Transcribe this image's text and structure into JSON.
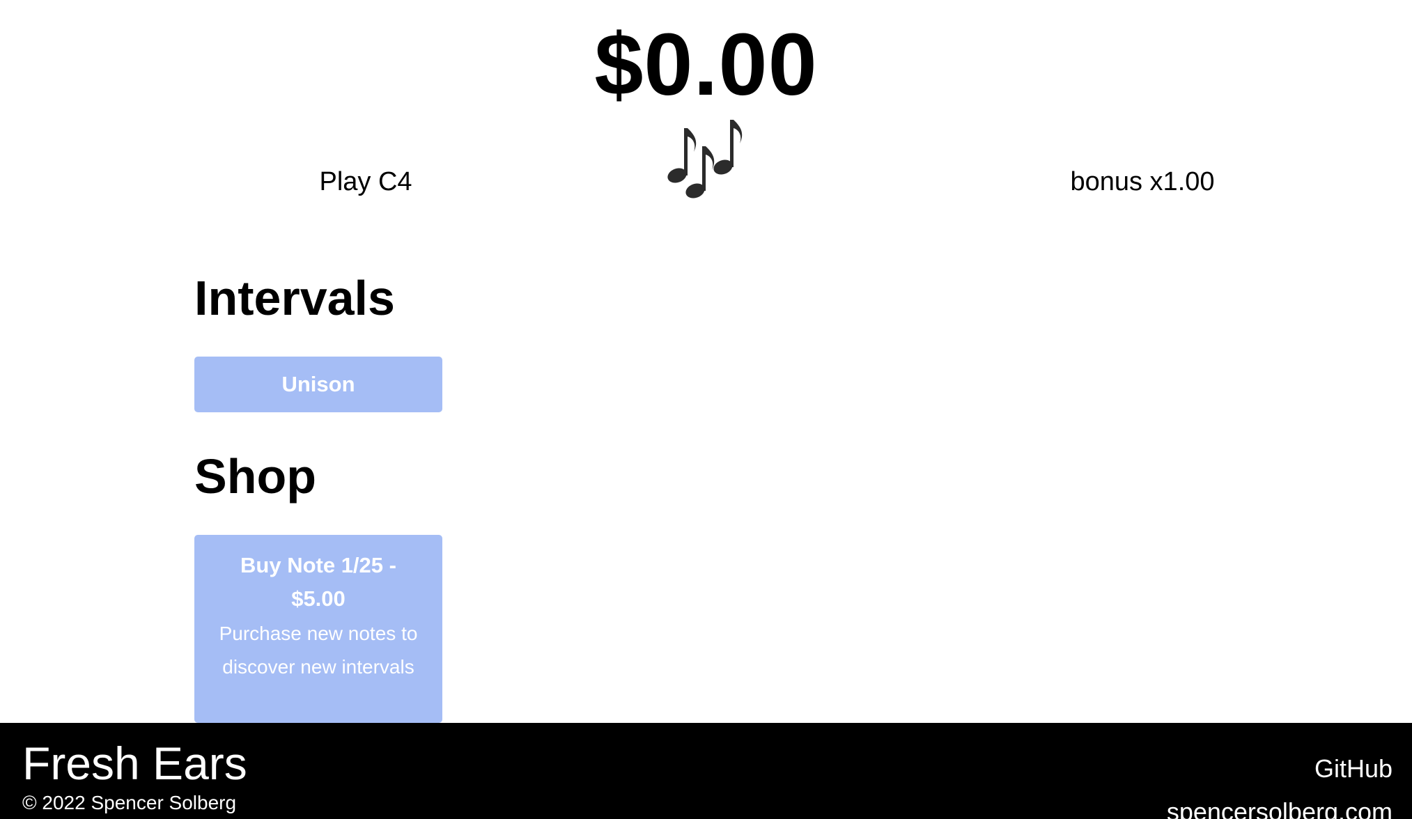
{
  "header": {
    "balance": "$0.00",
    "play_label": "Play C4",
    "notes_icon": "musical-notes-icon",
    "bonus": "bonus x1.00"
  },
  "intervals": {
    "title": "Intervals",
    "items": [
      {
        "label": "Unison"
      }
    ]
  },
  "shop": {
    "title": "Shop",
    "items": [
      {
        "label": "Buy Note 1/25 - $5.00",
        "description": "Purchase new notes to discover new intervals"
      }
    ]
  },
  "footer": {
    "brand": "Fresh Ears",
    "copyright": "© 2022 Spencer Solberg",
    "links": [
      {
        "label": "GitHub"
      },
      {
        "label": "spencersolberg.com"
      }
    ]
  },
  "colors": {
    "button_bg": "#a5bdf5",
    "button_text": "#ffffff",
    "footer_bg": "#000000"
  }
}
